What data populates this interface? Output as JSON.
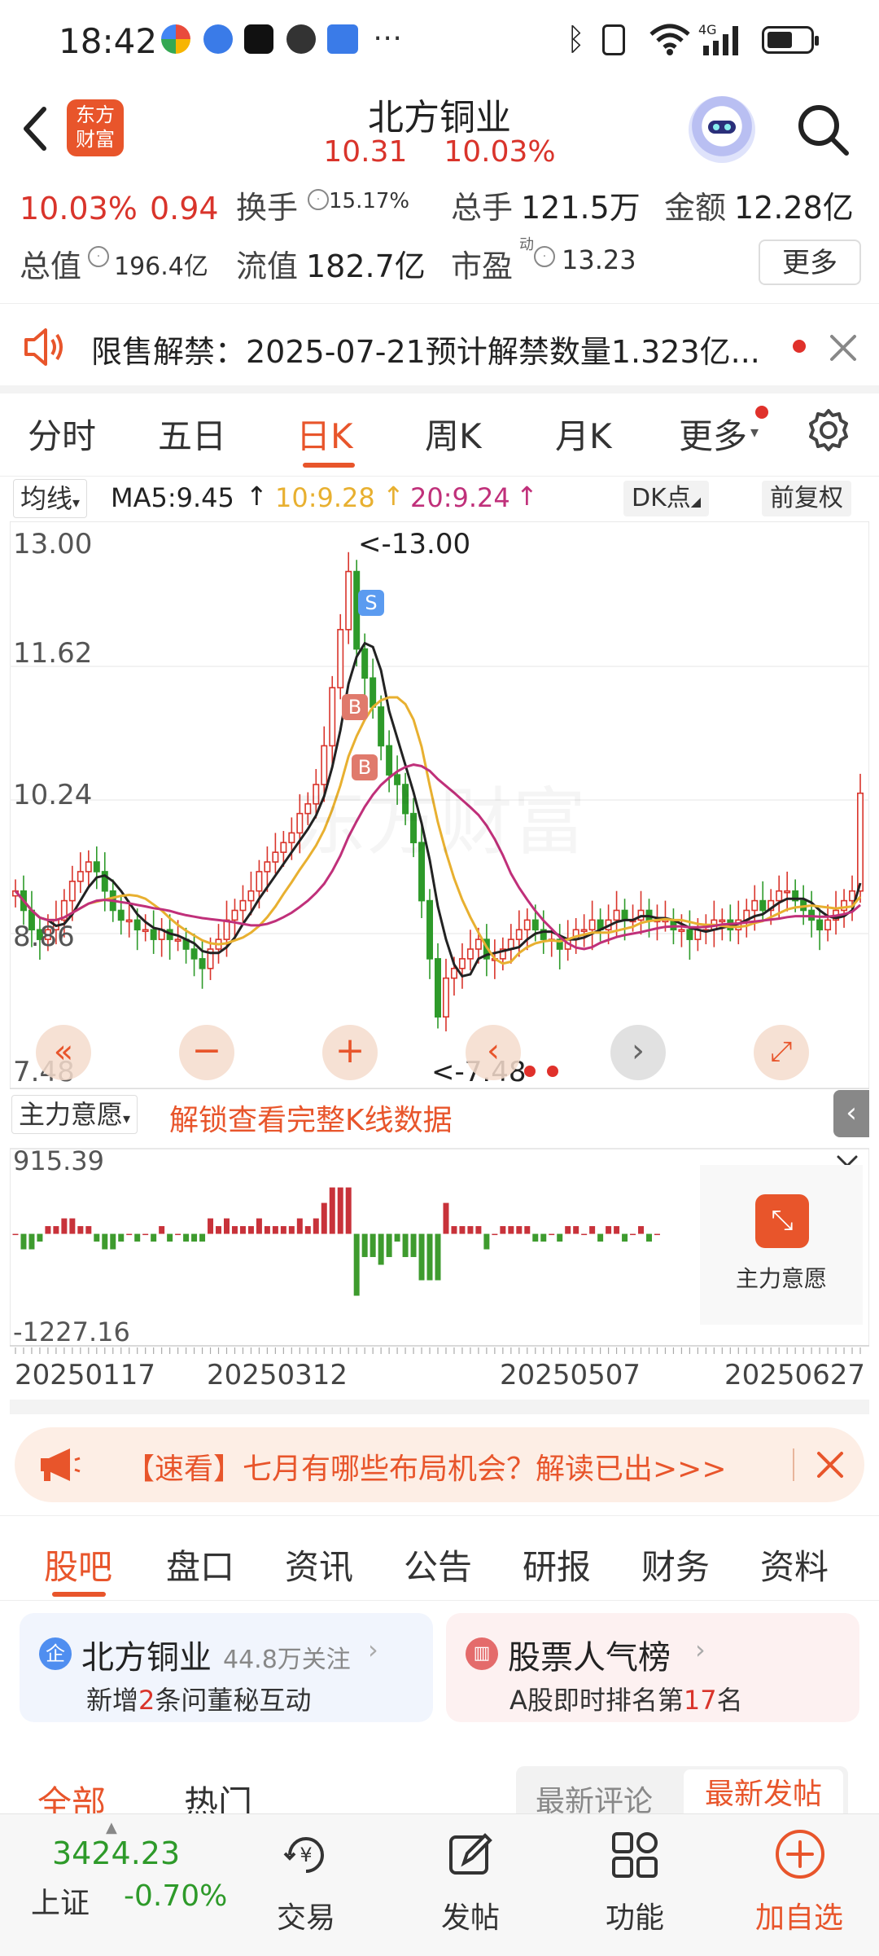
{
  "status_bar": {
    "time": "18:42"
  },
  "header": {
    "title": "北方铜业",
    "price": "10.31",
    "change_pct": "10.03%",
    "logo_line1": "东方",
    "logo_line2": "财富"
  },
  "quote": {
    "change_pct": "10.03%",
    "change_amt": "0.94",
    "turnover_label": "换手",
    "turnover_value": "15.17%",
    "volume_label": "总手",
    "volume_value": "121.5万",
    "amount_label": "金额",
    "amount_value": "12.28亿",
    "total_mv_label": "总值",
    "total_mv_value": "196.4亿",
    "float_mv_label": "流值",
    "float_mv_value": "182.7亿",
    "pe_label": "市盈",
    "pe_sup": "动",
    "pe_value": "13.23",
    "more_label": "更多"
  },
  "notice": {
    "text": "限售解禁：2025-07-21预计解禁数量1.323亿..."
  },
  "kline_tabs": [
    "分时",
    "五日",
    "日K",
    "周K",
    "月K",
    "更多"
  ],
  "active_tab": "日K",
  "chart_toolbar": {
    "ma_select": "均线",
    "ma5": "MA5:9.45",
    "ma10": "10:9.28",
    "ma20": "20:9.24",
    "dk_label": "DK点",
    "adjust_label": "前复权"
  },
  "chart_data": [
    {
      "type": "candlestick",
      "y_ticks": [
        "13.00",
        "11.62",
        "10.24",
        "8.86",
        "7.48"
      ],
      "ylim": [
        7.48,
        13.0
      ],
      "high_marker": "<-13.00",
      "low_marker": "<-7.48",
      "signals": [
        "S",
        "B",
        "B"
      ],
      "ma_lines": [
        {
          "name": "MA5",
          "color": "#222222"
        },
        {
          "name": "MA10",
          "color": "#e8b030"
        },
        {
          "name": "MA20",
          "color": "#c0307a"
        }
      ],
      "close_series": [
        9.3,
        9.1,
        8.9,
        8.8,
        8.9,
        9.0,
        9.2,
        9.4,
        9.5,
        9.6,
        9.5,
        9.3,
        9.1,
        9.0,
        9.0,
        8.9,
        8.9,
        8.8,
        8.9,
        8.8,
        8.8,
        8.7,
        8.6,
        8.5,
        8.7,
        8.8,
        9.0,
        9.1,
        9.2,
        9.3,
        9.5,
        9.6,
        9.7,
        9.8,
        9.9,
        10.1,
        10.2,
        10.4,
        10.8,
        11.4,
        12.0,
        12.6,
        11.8,
        11.5,
        11.2,
        10.8,
        10.5,
        10.4,
        10.1,
        9.8,
        9.2,
        8.6,
        8.0,
        8.4,
        8.5,
        8.6,
        8.7,
        8.8,
        8.6,
        8.6,
        8.7,
        8.8,
        8.9,
        9.0,
        8.9,
        8.8,
        8.8,
        8.7,
        8.8,
        8.9,
        8.9,
        9.0,
        8.9,
        9.0,
        9.1,
        9.0,
        9.0,
        9.1,
        9.0,
        9.0,
        9.0,
        8.9,
        8.9,
        8.8,
        8.9,
        8.9,
        9.0,
        9.0,
        8.9,
        9.0,
        9.1,
        9.2,
        9.1,
        9.2,
        9.3,
        9.3,
        9.2,
        9.1,
        9.0,
        8.9,
        9.0,
        9.1,
        9.2,
        9.3,
        10.31
      ],
      "volume_indicator": {
        "name": "主力意愿",
        "ylim": [
          -1227.16,
          915.39
        ],
        "y_ticks": [
          "915.39",
          "-1227.16"
        ]
      },
      "x_ticks": [
        "20250117",
        "20250312",
        "20250507",
        "20250627"
      ]
    }
  ],
  "chart_controls": {
    "unlock_text": "解锁查看完整K线数据",
    "indicator_select": "主力意愿",
    "lock_card_label": "主力意愿"
  },
  "banner": {
    "text": "【速看】七月有哪些布局机会？解读已出>>>"
  },
  "bottom_tabs": [
    "股吧",
    "盘口",
    "资讯",
    "公告",
    "研报",
    "财务",
    "资料"
  ],
  "card_left": {
    "name": "北方铜业",
    "followers": "44.8万关注",
    "line_prefix": "新增",
    "line_num": "2",
    "line_suffix": "条问董秘互动"
  },
  "card_right": {
    "title": "股票人气榜",
    "line_prefix": "A股即时排名第",
    "line_num": "17",
    "line_suffix": "名"
  },
  "feed_tabs": {
    "all": "全部",
    "hot": "热门",
    "latest_comment": "最新评论",
    "latest_post": "最新发帖"
  },
  "bottom_nav": {
    "index_value": "3424.23",
    "index_name": "上证",
    "index_change": "-0.70%",
    "trade": "交易",
    "post": "发帖",
    "function": "功能",
    "add_watch": "加自选"
  }
}
